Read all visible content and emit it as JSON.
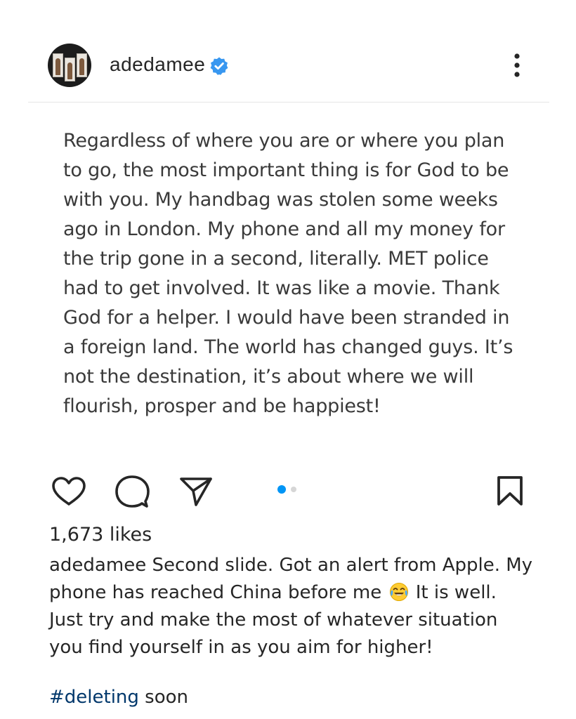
{
  "post": {
    "username": "adedamee",
    "verified": true,
    "slide_text_lines": [
      "Regardless of where you are or where you plan",
      "to go, the most important thing is for God to be",
      "with you. My handbag was stolen some weeks",
      "ago in London. My phone and all my money for",
      "the trip gone in a second, literally. MET police",
      "had to get involved. It was like a movie. Thank",
      "God for a helper. I would have been stranded in",
      "a foreign land. The world has changed guys. It’s",
      "not the destination, it’s about where we will",
      "flourish, prosper and be happiest!"
    ],
    "carousel": {
      "total_slides": 2,
      "active_slide": 1,
      "active_color": "#0095f6",
      "inactive_color": "#d6d6d6"
    },
    "likes_text": "1,673 likes",
    "caption": {
      "username": "adedamee",
      "line1_rest": "Second slide. Got an alert from Apple. My",
      "line2_before_emoji": "phone has reached China before me",
      "emoji": "face-with-tears-of-joy-emoji",
      "line2_after_emoji": "It is well.",
      "line3": "Just try and make the most of whatever situation",
      "line4": "you find yourself in as you aim for higher!"
    },
    "hashtag": "#deleting",
    "hashtag_rest": "soon"
  },
  "icons": {
    "verified": "verified-badge-icon",
    "more": "more-options-icon",
    "like": "heart-icon",
    "comment": "comment-bubble-icon",
    "share": "paper-plane-icon",
    "save": "bookmark-icon"
  },
  "colors": {
    "verified_badge": "#3897f0",
    "hashtag": "#00376b",
    "text": "#262626"
  }
}
